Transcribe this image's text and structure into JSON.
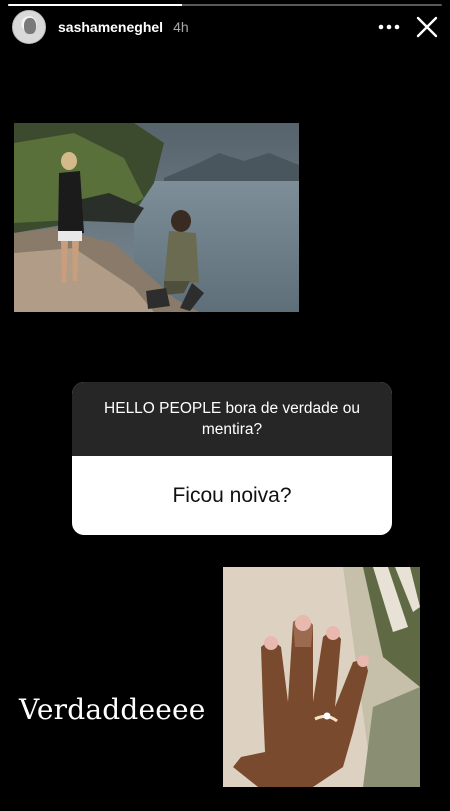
{
  "story": {
    "progress": 0.4,
    "username": "sashameneghel",
    "time": "4h"
  },
  "question": {
    "prompt": "HELLO PEOPLE bora de verdade ou mentira?",
    "answer": "Ficou noiva?"
  },
  "response_text": "Verdaddeeee",
  "icons": {
    "more": "more-horizontal-icon",
    "close": "close-icon",
    "avatar": "profile-avatar"
  }
}
